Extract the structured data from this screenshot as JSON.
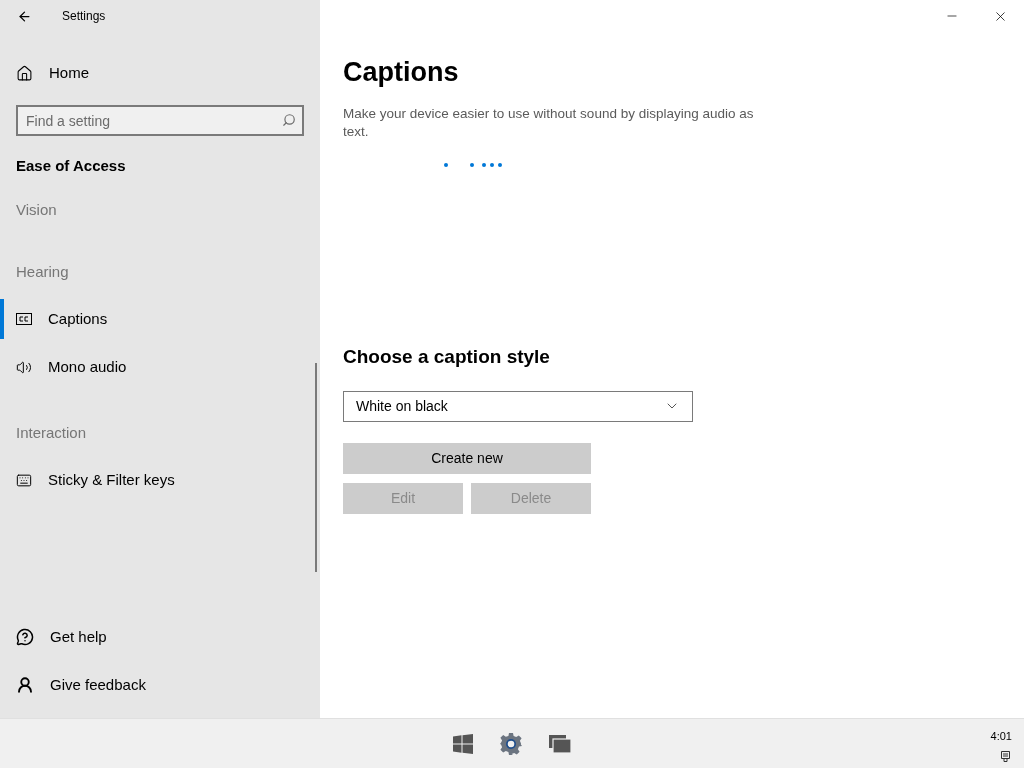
{
  "window": {
    "title": "Settings"
  },
  "sidebar": {
    "home": "Home",
    "search": {
      "placeholder": "Find a setting"
    },
    "section_title": "Ease of Access",
    "items": [
      {
        "kind": "group",
        "label": "Vision"
      },
      {
        "kind": "group",
        "label": "Hearing"
      },
      {
        "kind": "nav",
        "label": "Captions",
        "selected": true
      },
      {
        "kind": "nav",
        "label": "Mono audio",
        "selected": false
      },
      {
        "kind": "group",
        "label": "Interaction"
      },
      {
        "kind": "nav",
        "label": "Sticky & Filter keys",
        "selected": false
      }
    ],
    "footer": [
      "Get help",
      "Give feedback"
    ]
  },
  "page": {
    "title": "Captions",
    "description": "Make your device easier to use without sound by displaying audio as text.",
    "style_heading": "Choose a caption style",
    "style_select": {
      "value": "White on black"
    },
    "buttons": [
      {
        "label": "Create new",
        "disabled": false,
        "wide": true
      },
      {
        "label": "Edit",
        "disabled": true,
        "wide": false
      },
      {
        "label": "Delete",
        "disabled": true,
        "wide": false
      }
    ]
  },
  "taskbar": {
    "time": "4:01"
  }
}
